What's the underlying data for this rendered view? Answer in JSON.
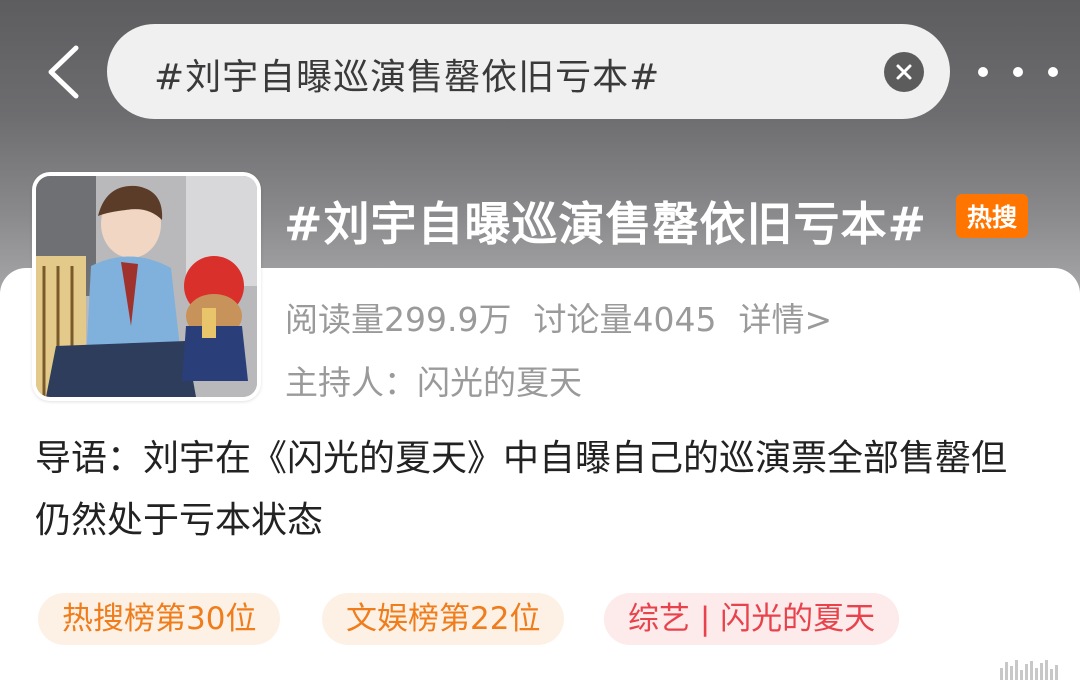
{
  "colors": {
    "hot_badge": "#ff7500",
    "tag_orange_text": "#f07d1c",
    "tag_orange_bg": "#fdf1e6",
    "tag_pink_text": "#e8434c",
    "tag_pink_bg": "#fdeaea"
  },
  "nav": {
    "back_icon": "chevron-left-icon",
    "search_value": "#刘宇自曝巡演售罄依旧亏本#",
    "clear_icon": "close-circle-icon",
    "more_icon": "more-dots-icon"
  },
  "topic": {
    "cover_image": "topic-cover-photo",
    "title": "#刘宇自曝巡演售罄依旧亏本#",
    "badge": "热搜",
    "reads": "阅读量299.9万",
    "discussions": "讨论量4045",
    "detail_link": "详情>",
    "host_label": "主持人：",
    "host_name": "闪光的夏天"
  },
  "intro": "导语：刘宇在《闪光的夏天》中自曝自己的巡演票全部售罄但仍然处于亏本状态",
  "tags": [
    {
      "label": "热搜榜第30位"
    },
    {
      "label": "文娱榜第22位"
    },
    {
      "label": "综艺 | 闪光的夏天"
    }
  ]
}
